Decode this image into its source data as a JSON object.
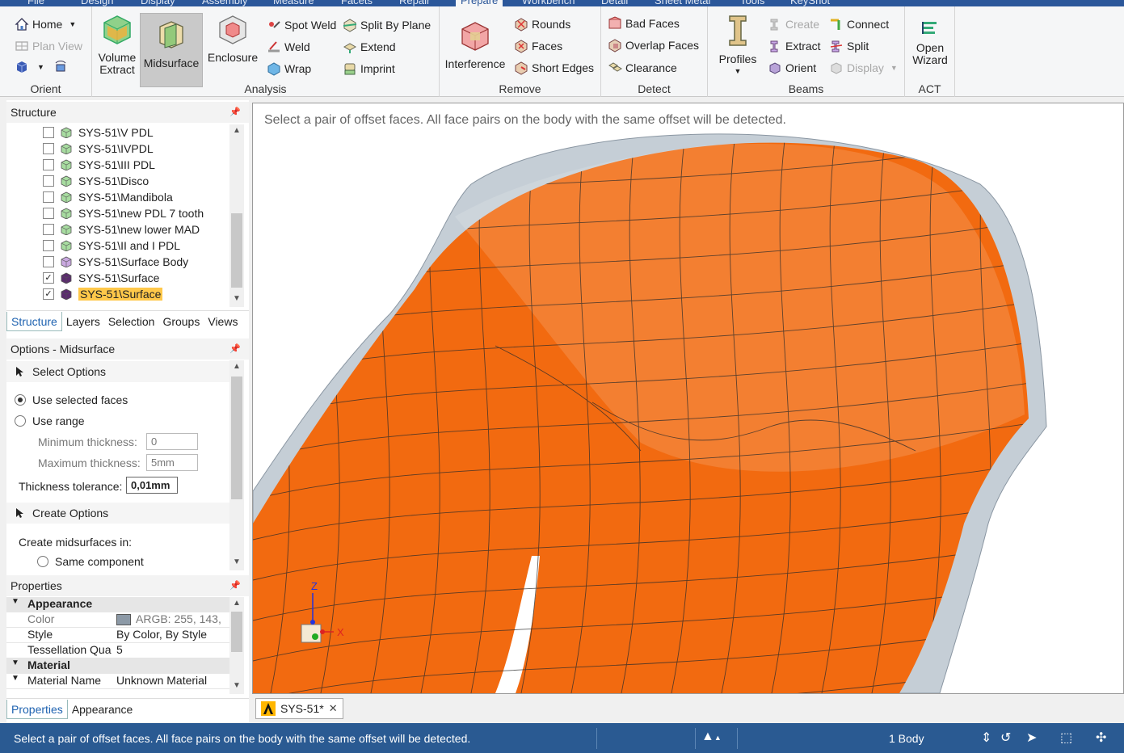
{
  "ribbon_tabs": [
    "File",
    "Design",
    "Display",
    "Assembly",
    "Measure",
    "Facets",
    "Repair",
    "Prepare",
    "Workbench",
    "Detail",
    "Sheet Metal",
    "Tools",
    "KeyShot"
  ],
  "orient": {
    "label": "Orient",
    "home": "Home",
    "plan_view": "Plan View"
  },
  "analysis": {
    "label": "Analysis",
    "volume_extract": "Volume Extract",
    "midsurface": "Midsurface",
    "enclosure": "Enclosure",
    "spot_weld": "Spot Weld",
    "weld": "Weld",
    "wrap": "Wrap",
    "split_by_plane": "Split By Plane",
    "extend": "Extend",
    "imprint": "Imprint"
  },
  "remove": {
    "label": "Remove",
    "interference": "Interference",
    "rounds": "Rounds",
    "faces": "Faces",
    "short_edges": "Short Edges"
  },
  "detect": {
    "label": "Detect",
    "bad_faces": "Bad Faces",
    "overlap_faces": "Overlap Faces",
    "clearance": "Clearance"
  },
  "beams": {
    "label": "Beams",
    "profiles": "Profiles",
    "create": "Create",
    "extract": "Extract",
    "orient": "Orient",
    "connect": "Connect",
    "split": "Split",
    "display": "Display"
  },
  "act": {
    "label": "ACT",
    "open_wizard": "Open Wizard"
  },
  "structure": {
    "title": "Structure",
    "items": [
      {
        "name": "SYS-51\\V PDL",
        "checked": false
      },
      {
        "name": "SYS-51\\IVPDL",
        "checked": false
      },
      {
        "name": "SYS-51\\III PDL",
        "checked": false
      },
      {
        "name": "SYS-51\\Disco",
        "checked": false
      },
      {
        "name": "SYS-51\\Mandibola",
        "checked": false
      },
      {
        "name": "SYS-51\\new PDL 7 tooth",
        "checked": false
      },
      {
        "name": "SYS-51\\new  lower MAD",
        "checked": false
      },
      {
        "name": "SYS-51\\II and I PDL",
        "checked": false
      },
      {
        "name": "SYS-51\\Surface Body",
        "checked": false
      },
      {
        "name": "SYS-51\\Surface",
        "checked": true
      },
      {
        "name": "SYS-51\\Surface",
        "checked": true
      }
    ],
    "tabs": [
      "Structure",
      "Layers",
      "Selection",
      "Groups",
      "Views"
    ]
  },
  "options": {
    "title": "Options - Midsurface",
    "select_options": "Select Options",
    "use_selected_faces": "Use selected faces",
    "use_range": "Use range",
    "min_thickness_label": "Minimum thickness:",
    "min_thickness_value": "0",
    "max_thickness_label": "Maximum thickness:",
    "max_thickness_value": "5mm",
    "tolerance_label": "Thickness tolerance:",
    "tolerance_value": "0,01mm",
    "create_options": "Create Options",
    "create_in_label": "Create midsurfaces in:",
    "same_component": "Same component"
  },
  "properties": {
    "title": "Properties",
    "appearance_cat": "Appearance",
    "color_key": "Color",
    "color_value": "ARGB: 255, 143,",
    "swatch_color": "#8c99a6",
    "style_key": "Style",
    "style_value": "By Color, By Style",
    "tess_key": "Tessellation Qua",
    "tess_value": "5",
    "material_cat": "Material",
    "material_key": "Material Name",
    "material_value": "Unknown Material",
    "tabs": [
      "Properties",
      "Appearance"
    ]
  },
  "viewport": {
    "hint": "Select a pair of offset faces. All face pairs on the body with the same offset will be detected.",
    "shape_color": "#f26a10",
    "shell_color": "#c5ced6"
  },
  "doc_tab": "SYS-51*",
  "status": {
    "message": "Select a pair of offset faces. All face pairs on the body with the same offset will be detected.",
    "bodies": "1 Body"
  }
}
